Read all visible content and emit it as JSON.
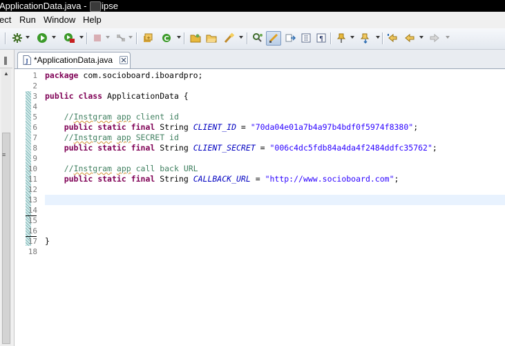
{
  "window": {
    "title": "ApplicationData.java - Eclipse"
  },
  "menubar": {
    "items": [
      "ect",
      "Run",
      "Window",
      "Help"
    ]
  },
  "toolbar": {
    "icons": [
      "debug-gear-icon",
      "run-icon",
      "run-external-icon",
      "stop-icon",
      "connect-icon",
      "new-java-class-icon",
      "refresh-icon",
      "open-folder-icon",
      "open-type-icon",
      "brush-icon",
      "search-icon",
      "toggle-highlight-icon",
      "next-annotation-icon",
      "prev-annotation-icon",
      "show-whitespace-icon",
      "pilcrow-icon",
      "pin-icon",
      "last-edit-icon",
      "back-icon",
      "forward-icon"
    ]
  },
  "editor": {
    "tab_label": "*ApplicationData.java",
    "line_numbers": [
      "1",
      "2",
      "3",
      "4",
      "5",
      "6",
      "7",
      "8",
      "9",
      "10",
      "11",
      "12",
      "13",
      "14",
      "15",
      "16",
      "17",
      "18"
    ],
    "code": {
      "package_kw": "package",
      "package_name": " com.socioboard.iboardpro;",
      "public_kw": "public",
      "class_kw": "class",
      "class_name": " ApplicationData {",
      "comment_prefix": "//",
      "comment_word1": "Instgram",
      "comment_word2": "app",
      "comment1_rest": " client id",
      "comment2_rest": " SECRET id",
      "comment3_rest": " call back URL",
      "static_kw": "static",
      "final_kw": "final",
      "type_string": " String ",
      "const1": "CLIENT_ID",
      "const2": "CLIENT_SECRET",
      "const3": "CALLBACK_URL",
      "assign": " = ",
      "val1": "\"70da04e01a7b4a97b4bdf0f5974f8380\"",
      "val2": "\"006c4dc5fdb84a4da4f2484ddfc35762\"",
      "val3": "\"http://www.socioboard.com\"",
      "semicolon": ";",
      "close_brace": "}"
    }
  }
}
